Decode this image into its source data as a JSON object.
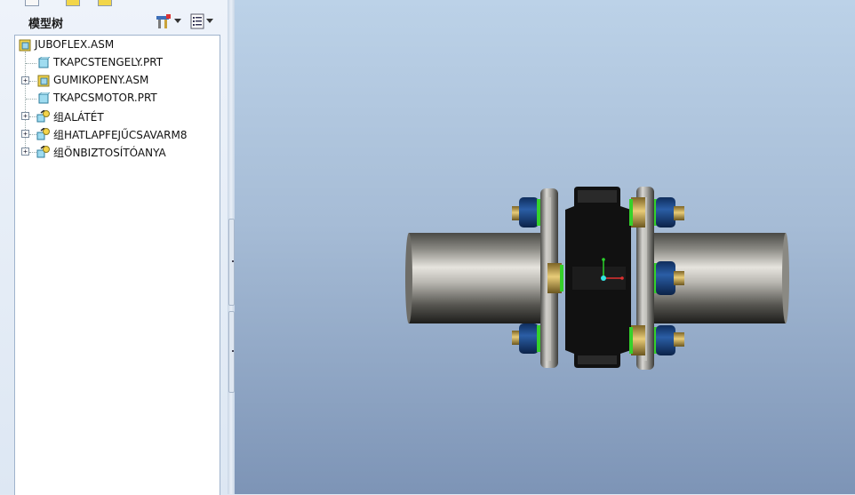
{
  "model_tree": {
    "title": "模型树",
    "root": {
      "label": "JUBOFLEX.ASM",
      "icon": "assembly-icon"
    },
    "items": [
      {
        "label": "TKAPCSTENGELY.PRT",
        "icon": "part-icon",
        "expandable": false
      },
      {
        "label": "GUMIKOPENY.ASM",
        "icon": "assembly-icon",
        "expandable": true
      },
      {
        "label": "TKAPCSMOTOR.PRT",
        "icon": "part-icon",
        "expandable": false
      },
      {
        "label": "组ALÁTÉT",
        "icon": "group-icon",
        "expandable": true
      },
      {
        "label": "组HATLAPFEJŰCSAVARM8",
        "icon": "group-icon",
        "expandable": true
      },
      {
        "label": "组ÖNBIZTOSÍTÓANYA",
        "icon": "group-icon",
        "expandable": true
      }
    ]
  },
  "colors": {
    "viewport_top": "#bcd2e8",
    "viewport_bottom": "#7d94b6",
    "nut_blue": "#163e78",
    "washer_green": "#35d12a",
    "bolt_gold": "#c6a243"
  }
}
